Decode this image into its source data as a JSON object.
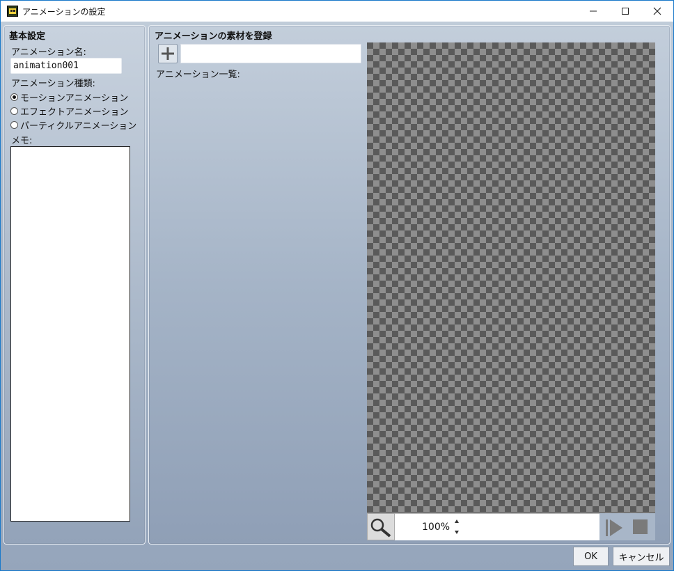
{
  "window": {
    "title": "アニメーションの設定",
    "controls": [
      "minimize-icon",
      "maximize-icon",
      "close-icon"
    ]
  },
  "basic": {
    "title": "基本設定",
    "name_label": "アニメーション名:",
    "name_value": "animation001",
    "type_label": "アニメーション種類:",
    "types": [
      {
        "label": "モーションアニメーション",
        "selected": true
      },
      {
        "label": "エフェクトアニメーション",
        "selected": false
      },
      {
        "label": "パーティクルアニメーション",
        "selected": false
      }
    ],
    "memo_label": "メモ:",
    "memo_value": ""
  },
  "assets": {
    "title": "アニメーションの素材を登録",
    "add_icon": "plus-icon",
    "asset_value": "",
    "list_label": "アニメーション一覧:"
  },
  "preview": {
    "zoom_icon": "magnifier-icon",
    "zoom": "100%",
    "play_icon": "play-icon",
    "stop_icon": "stop-icon"
  },
  "footer": {
    "ok": "OK",
    "cancel": "キャンセル"
  }
}
